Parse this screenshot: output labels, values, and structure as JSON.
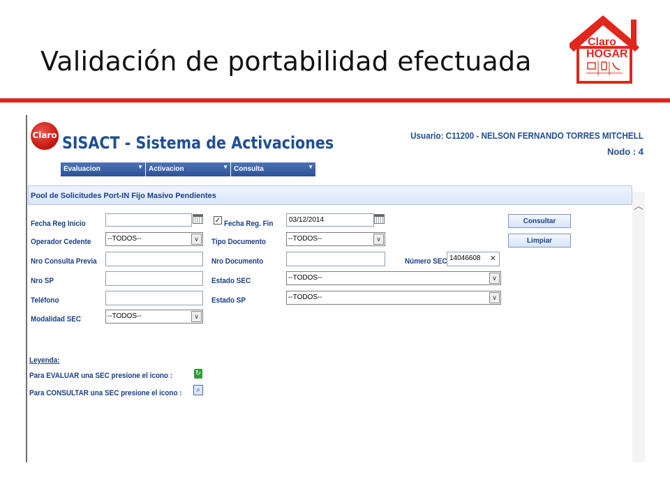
{
  "slide": {
    "title": "Validación de portabilidad efectuada",
    "logo": {
      "line1": "Claro",
      "line2": "HOGAR",
      "icons": [
        "tv-icon",
        "phone-icon",
        "telephone-icon"
      ]
    },
    "accent_color": "#e1261c"
  },
  "app": {
    "logo_text": "Claro",
    "title": "SISACT - Sistema de Activaciones",
    "user": "Usuario: C11200 - NELSON FERNANDO TORRES MITCHELL",
    "nodo": "Nodo : 4",
    "menu": [
      {
        "label": "Evaluacion"
      },
      {
        "label": "Activacion"
      },
      {
        "label": "Consulta"
      }
    ]
  },
  "pool": {
    "title": "Pool de Solicitudes Port-IN Fijo Masivo Pendientes"
  },
  "form": {
    "fecha_reg_inicio": {
      "label": "Fecha Reg Inicio",
      "value": ""
    },
    "fecha_reg_fin": {
      "label": "Fecha Reg. Fin",
      "value": "03/12/2014",
      "checked": true
    },
    "operador_cedente": {
      "label": "Operador Cedente",
      "value": "--TODOS--"
    },
    "tipo_documento": {
      "label": "Tipo Documento",
      "value": "--TODOS--"
    },
    "nro_consulta_previa": {
      "label": "Nro Consulta Previa",
      "value": ""
    },
    "nro_documento": {
      "label": "Nro Documento",
      "value": ""
    },
    "numero_sec": {
      "label": "Número SEC",
      "value": "14046608"
    },
    "nro_sp": {
      "label": "Nro SP",
      "value": ""
    },
    "estado_sec": {
      "label": "Estado SEC",
      "value": "--TODOS--"
    },
    "telefono": {
      "label": "Teléfono",
      "value": ""
    },
    "estado_sp": {
      "label": "Estado SP",
      "value": "--TODOS--"
    },
    "modalidad_sec": {
      "label": "Modalidad SEC",
      "value": "--TODOS--"
    },
    "consultar_label": "Consultar",
    "limpiar_label": "Limpiar"
  },
  "leyenda": {
    "title": "Leyenda:",
    "evaluar": "Para EVALUAR una SEC presione el icono :",
    "consultar": "Para CONSULTAR una SEC presione el icono :"
  }
}
